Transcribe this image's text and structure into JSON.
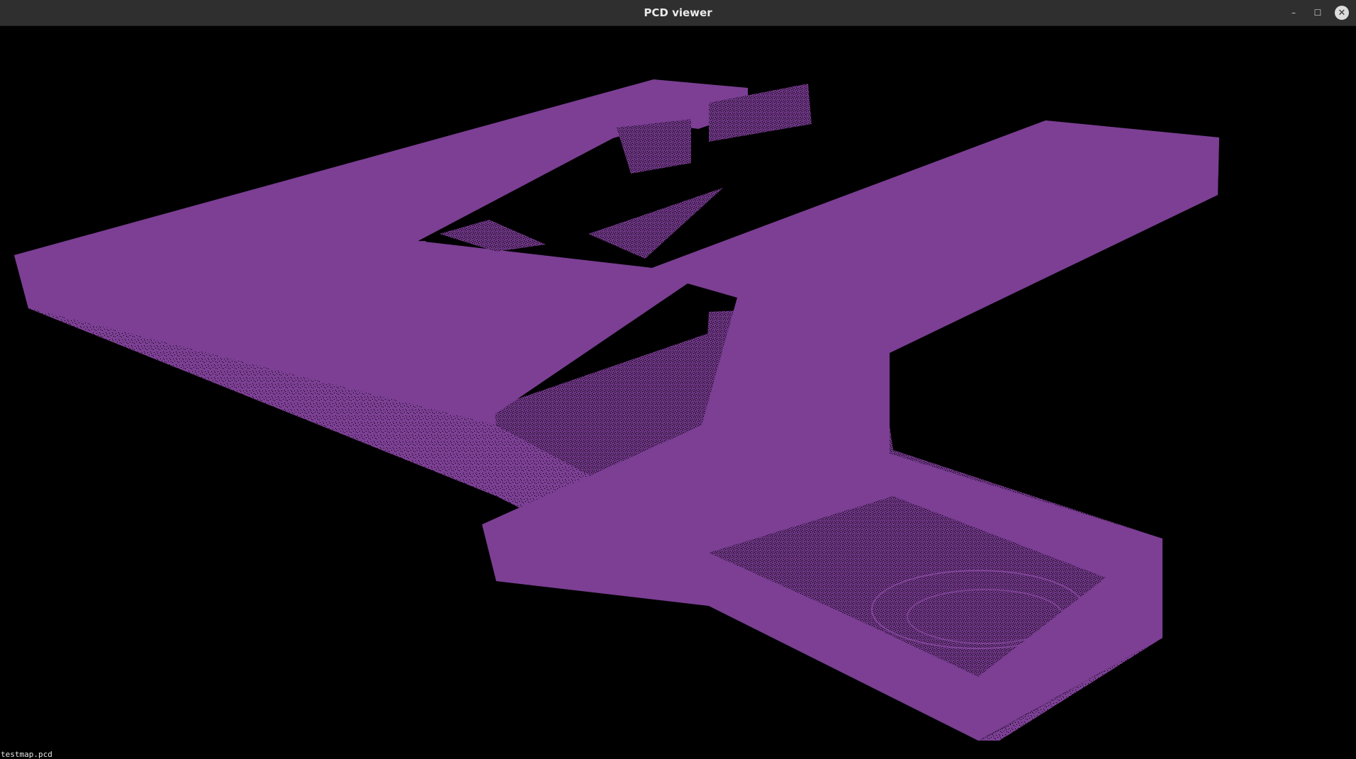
{
  "window": {
    "title": "PCD viewer",
    "controls": {
      "minimize_icon": "–",
      "maximize_icon": "☐",
      "close_icon": "✕"
    }
  },
  "viewer": {
    "background_color": "#000000",
    "point_color": "#7c3f94",
    "status_text": "testmap.pcd"
  }
}
